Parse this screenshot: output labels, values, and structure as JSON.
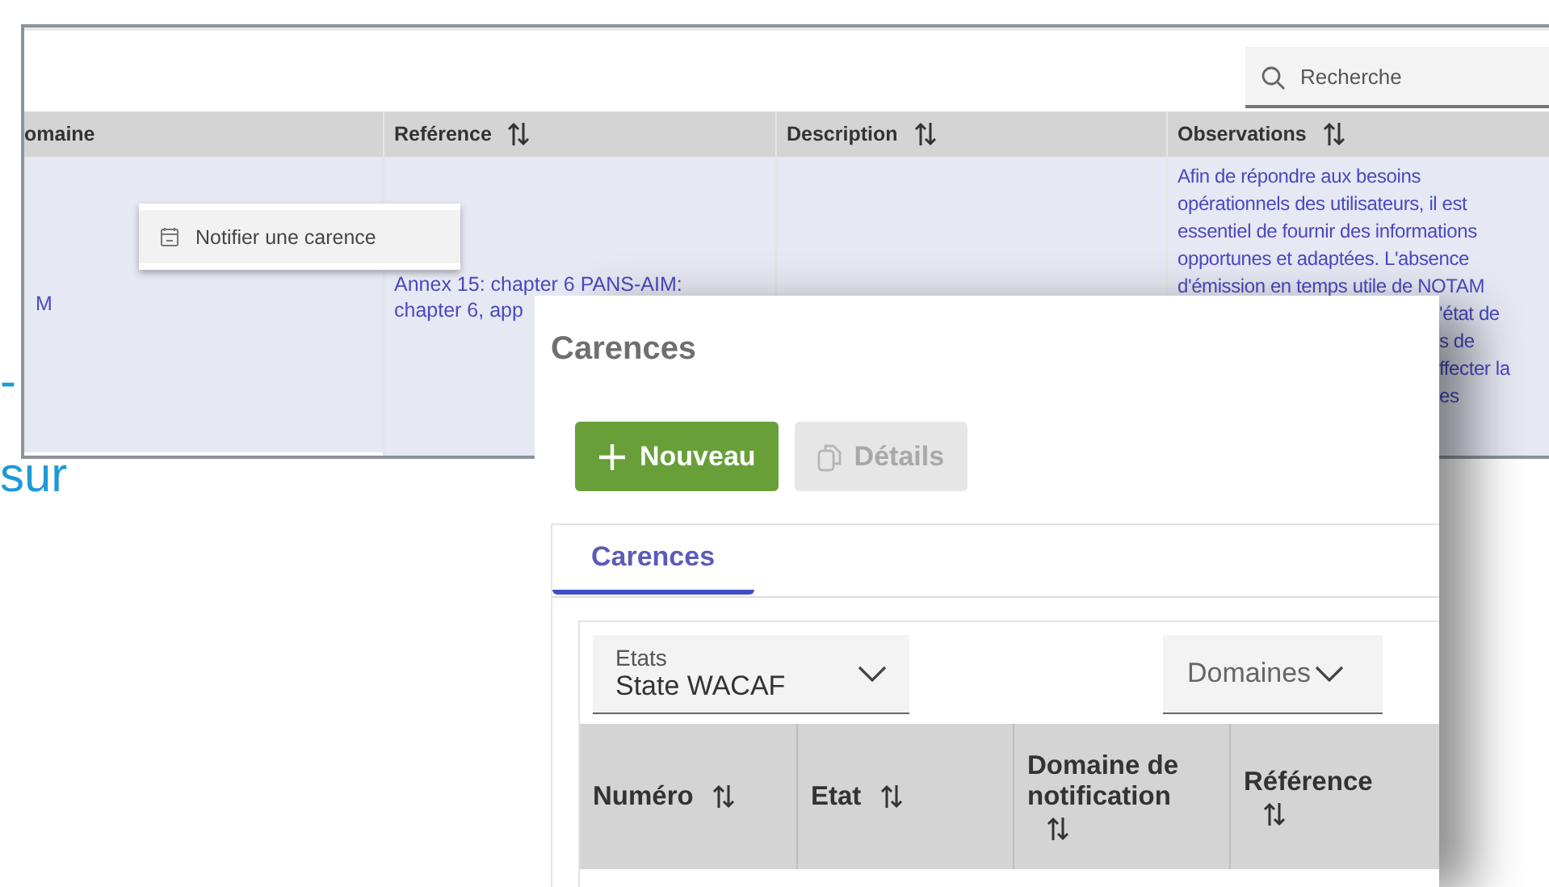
{
  "document_fragments": [
    {
      "text": "-"
    },
    {
      "text": "sur"
    }
  ],
  "back_table": {
    "search": {
      "placeholder": "Recherche"
    },
    "columns": [
      {
        "label": "omaine",
        "sortable": false
      },
      {
        "label": "Reférence",
        "sortable": true
      },
      {
        "label": "Description",
        "sortable": true
      },
      {
        "label": "Observations",
        "sortable": true
      }
    ],
    "row": {
      "selected": true,
      "cells": [
        {
          "lines": [
            {
              "text": "M",
              "kind": "full"
            }
          ]
        },
        {
          "lines": [
            {
              "text": "Annex 15: chapter 6 PANS-AIM:",
              "kind": "full"
            },
            {
              "text": "chapter 6, app",
              "kind": "full"
            }
          ]
        },
        {},
        {
          "lines": [
            {
              "text": "Afin de répondre aux besoins",
              "kind": "full"
            },
            {
              "text": "opérationnels des utilisateurs, il est",
              "kind": "full"
            },
            {
              "text": "essentiel de fournir des informations",
              "kind": "full"
            },
            {
              "text": "opportunes et adaptées. L'absence",
              "kind": "full"
            },
            {
              "text": "d'émission en temps utile de NOTAM",
              "kind": "full"
            },
            {
              "text": "'état de",
              "kind": "fragment"
            },
            {
              "text": "s de",
              "kind": "fragment"
            },
            {
              "text": "ffecter la",
              "kind": "fragment"
            },
            {
              "text": "es",
              "kind": "fragment"
            }
          ]
        }
      ]
    }
  },
  "context_menu": {
    "items": [
      {
        "label": "Notifier une carence"
      }
    ]
  },
  "dialog": {
    "title": "Carences",
    "buttons": [
      {
        "label": "Nouveau",
        "kind": "primary",
        "disabled": false
      },
      {
        "label": "Détails",
        "kind": "details",
        "disabled": true
      }
    ],
    "tabs": [
      {
        "label": "Carences",
        "selected": true
      }
    ],
    "filters": [
      {
        "kind": "select",
        "label": "Etats",
        "value": "State WACAF"
      },
      {
        "kind": "placeholder",
        "placeholder": "Domaines"
      }
    ],
    "columns": [
      {
        "label": "Numéro",
        "sortable": true
      },
      {
        "label": "Etat",
        "sortable": true
      },
      {
        "label": "Domaine de notification",
        "sortable": true
      },
      {
        "label": "Référence",
        "sortable": true
      }
    ]
  }
}
